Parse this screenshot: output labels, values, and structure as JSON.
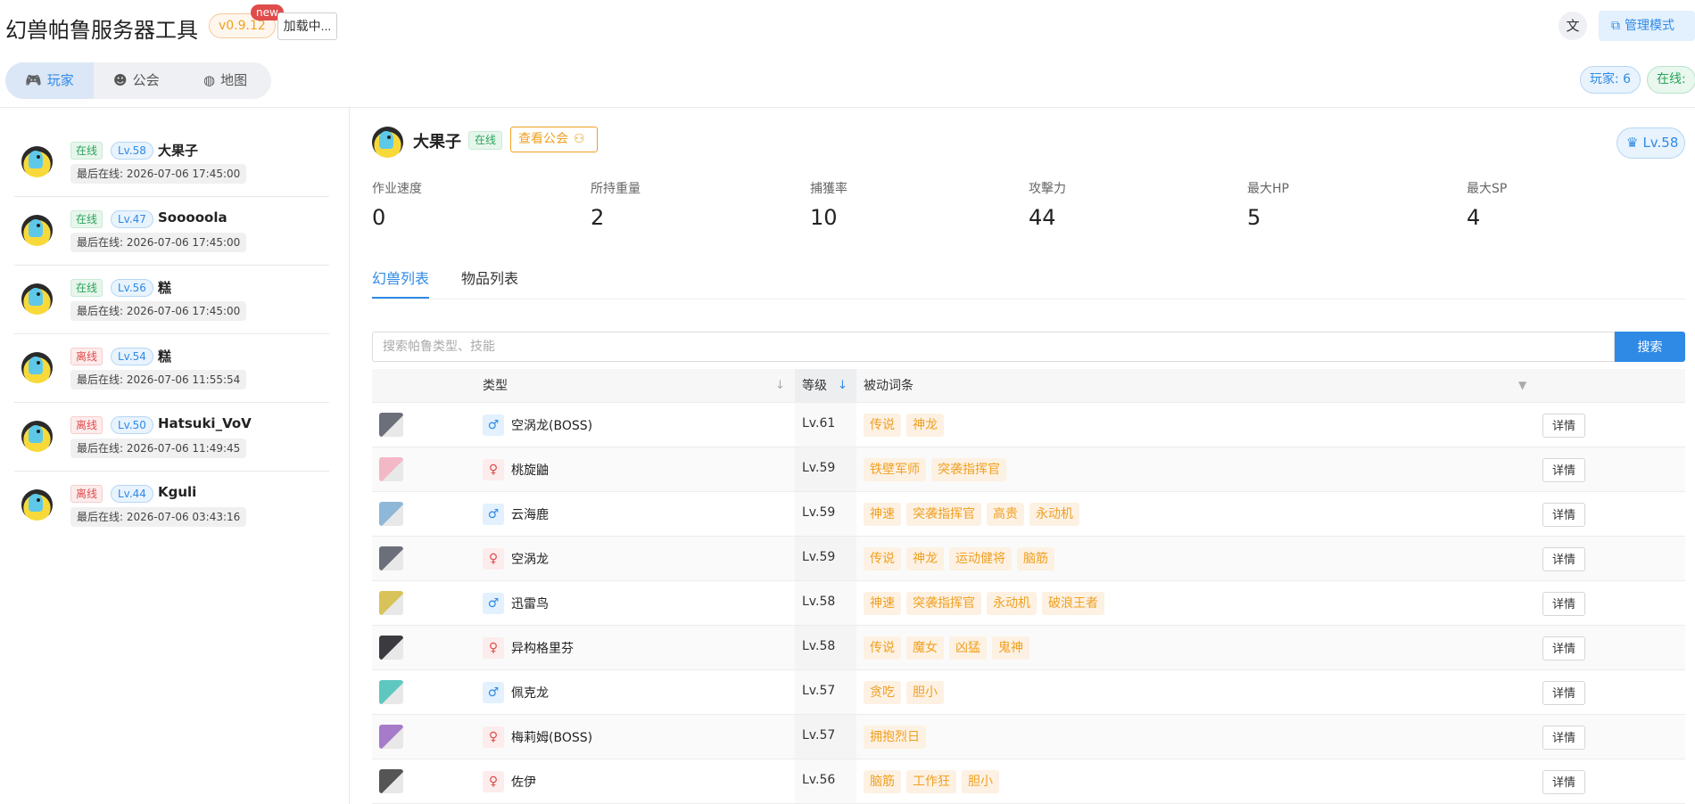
{
  "header": {
    "app_title": "幻兽帕鲁服务器工具",
    "version": "v0.9.12",
    "new_badge": "new",
    "loading_button": "加载中...",
    "lang_icon": "translate-icon",
    "admin_button": "管理模式"
  },
  "nav": {
    "tabs": [
      {
        "label": "玩家",
        "icon": "gamepad-icon",
        "active": true
      },
      {
        "label": "公会",
        "icon": "guild-icon",
        "active": false
      },
      {
        "label": "地图",
        "icon": "globe-icon",
        "active": false
      }
    ]
  },
  "counters": {
    "players": "玩家: 6",
    "online": "在线:"
  },
  "players": [
    {
      "status": "在线",
      "level": "Lv.58",
      "name": "大果子",
      "last_online": "最后在线: 2026-07-06 17:45:00",
      "online": true
    },
    {
      "status": "在线",
      "level": "Lv.47",
      "name": "Sooooola",
      "last_online": "最后在线: 2026-07-06 17:45:00",
      "online": true
    },
    {
      "status": "在线",
      "level": "Lv.56",
      "name": "糕",
      "last_online": "最后在线: 2026-07-06 17:45:00",
      "online": true
    },
    {
      "status": "离线",
      "level": "Lv.54",
      "name": "糕",
      "last_online": "最后在线: 2026-07-06 11:55:54",
      "online": false
    },
    {
      "status": "离线",
      "level": "Lv.50",
      "name": "Hatsuki_VoV",
      "last_online": "最后在线: 2026-07-06 11:49:45",
      "online": false
    },
    {
      "status": "离线",
      "level": "Lv.44",
      "name": "Kguli",
      "last_online": "最后在线: 2026-07-06 03:43:16",
      "online": false
    }
  ],
  "detail": {
    "name": "大果子",
    "status": "在线",
    "guild_button": "查看公会",
    "level": "Lv.58",
    "stats": [
      {
        "label": "作业速度",
        "value": "0"
      },
      {
        "label": "所持重量",
        "value": "2"
      },
      {
        "label": "捕獲率",
        "value": "10"
      },
      {
        "label": "攻擊力",
        "value": "44"
      },
      {
        "label": "最大HP",
        "value": "5"
      },
      {
        "label": "最大SP",
        "value": "4"
      }
    ],
    "tabs": [
      {
        "label": "幻兽列表",
        "active": true
      },
      {
        "label": "物品列表",
        "active": false
      }
    ],
    "search": {
      "placeholder": "搜索帕鲁类型、技能",
      "button": "搜索"
    },
    "table": {
      "headers": {
        "type": "类型",
        "level": "等级",
        "skills": "被动词条"
      },
      "detail_label": "详情",
      "rows": [
        {
          "gender": "♂",
          "male": true,
          "type": "空涡龙(BOSS)",
          "level": "Lv.61",
          "skills": [
            "传说",
            "神龙"
          ],
          "color": "#6b6f7a"
        },
        {
          "gender": "♀",
          "male": false,
          "type": "桃旋鼬",
          "level": "Lv.59",
          "skills": [
            "铁壁军师",
            "突袭指挥官"
          ],
          "color": "#f2b8c6"
        },
        {
          "gender": "♂",
          "male": true,
          "type": "云海鹿",
          "level": "Lv.59",
          "skills": [
            "神速",
            "突袭指挥官",
            "高贵",
            "永动机"
          ],
          "color": "#8fb7d8"
        },
        {
          "gender": "♀",
          "male": false,
          "type": "空涡龙",
          "level": "Lv.59",
          "skills": [
            "传说",
            "神龙",
            "运动健将",
            "脑筋"
          ],
          "color": "#6b6f7a"
        },
        {
          "gender": "♂",
          "male": true,
          "type": "迅雷鸟",
          "level": "Lv.58",
          "skills": [
            "神速",
            "突袭指挥官",
            "永动机",
            "破浪王者"
          ],
          "color": "#d8c25a"
        },
        {
          "gender": "♀",
          "male": false,
          "type": "异构格里芬",
          "level": "Lv.58",
          "skills": [
            "传说",
            "魔女",
            "凶猛",
            "鬼神"
          ],
          "color": "#3a3a3f"
        },
        {
          "gender": "♂",
          "male": true,
          "type": "佩克龙",
          "level": "Lv.57",
          "skills": [
            "贪吃",
            "胆小"
          ],
          "color": "#5ec8c0"
        },
        {
          "gender": "♀",
          "male": false,
          "type": "梅莉姆(BOSS)",
          "level": "Lv.57",
          "skills": [
            "拥抱烈日"
          ],
          "color": "#a67bc9"
        },
        {
          "gender": "♀",
          "male": false,
          "type": "佐伊",
          "level": "Lv.56",
          "skills": [
            "脑筋",
            "工作狂",
            "胆小"
          ],
          "color": "#555555"
        }
      ]
    }
  }
}
